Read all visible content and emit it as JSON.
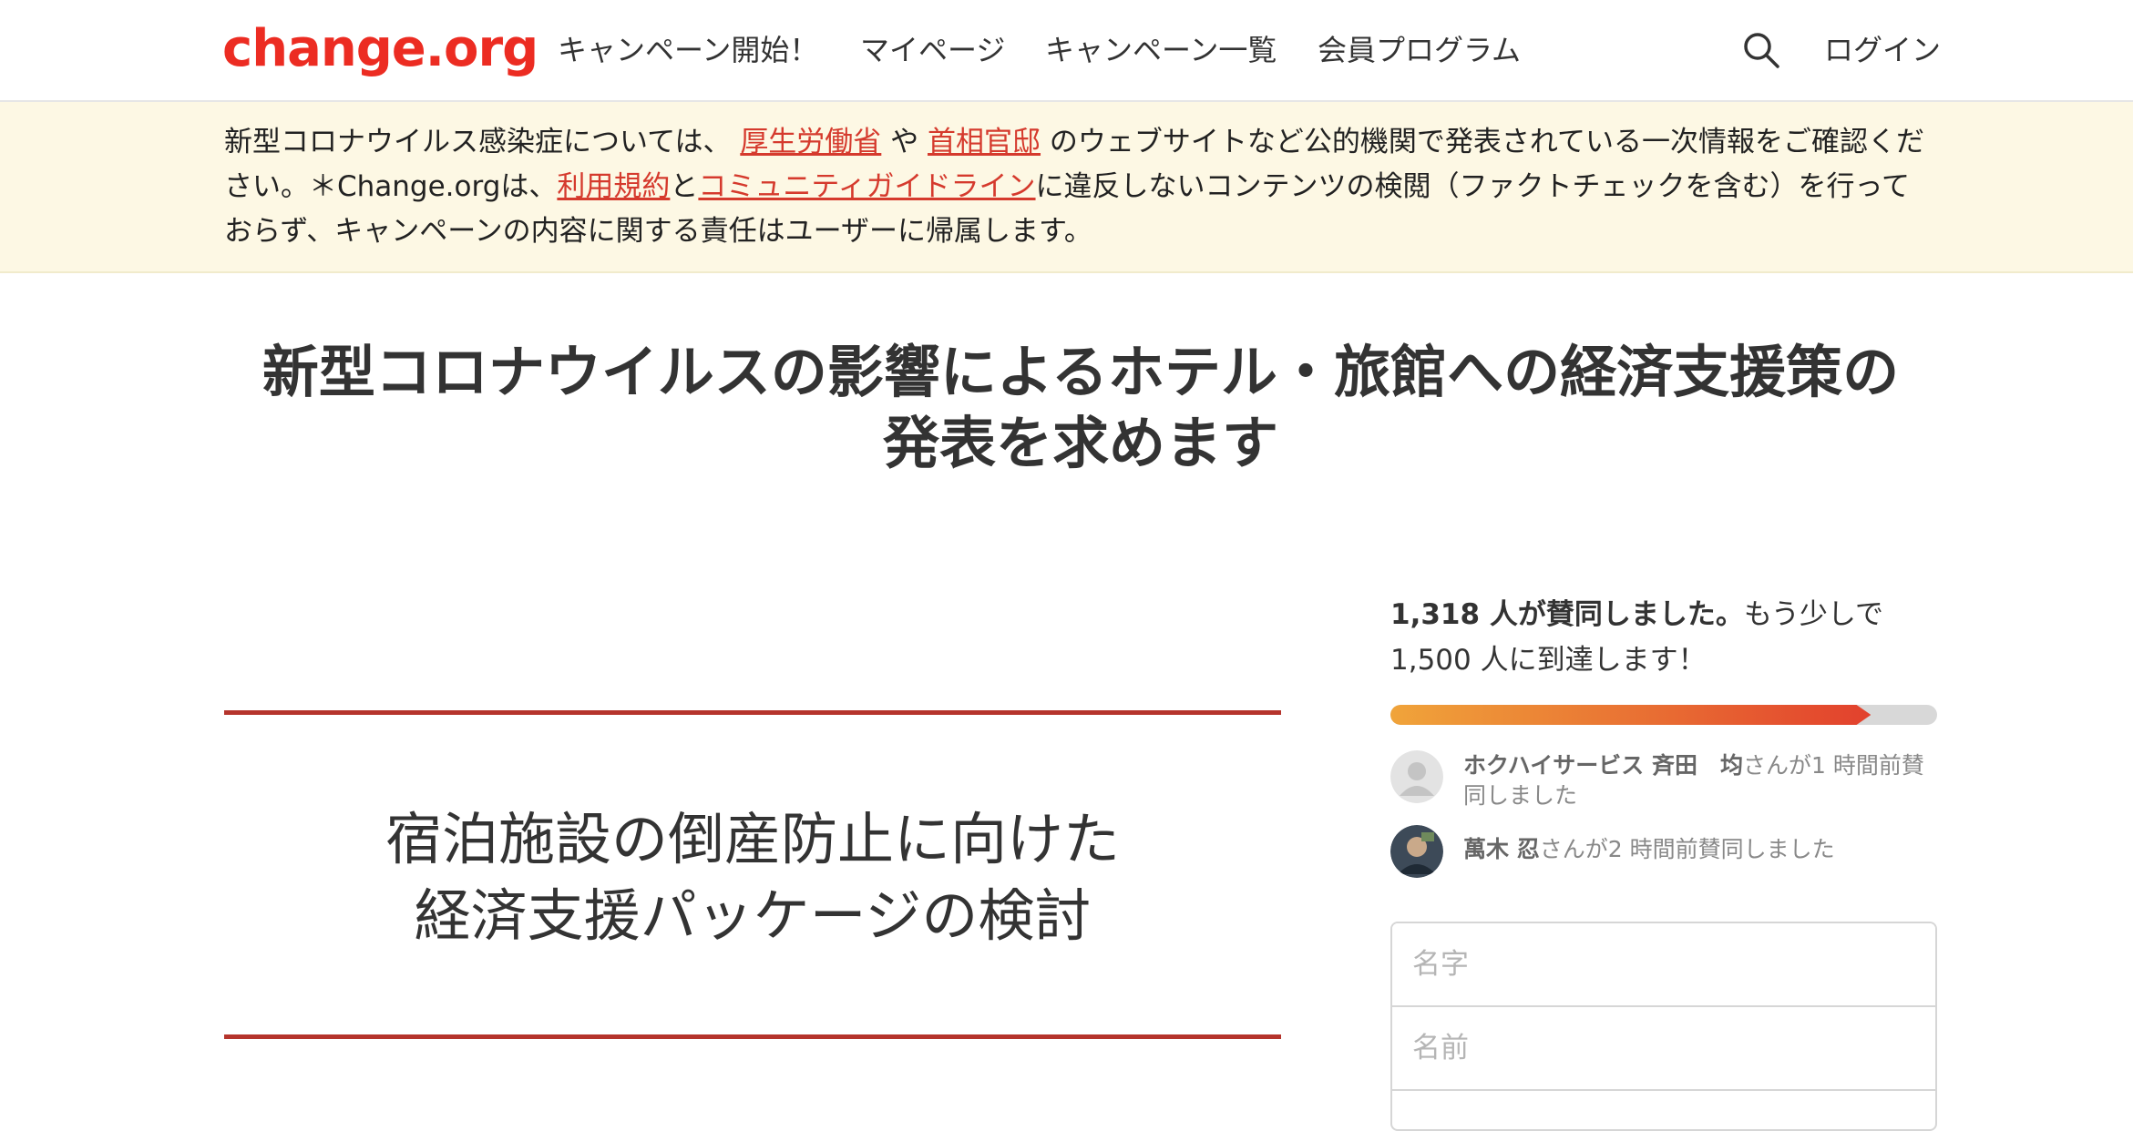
{
  "header": {
    "logo": "change.org",
    "nav": [
      "キャンペーン開始！",
      "マイページ",
      "キャンペーン一覧",
      "会員プログラム"
    ],
    "search_icon": "search-icon",
    "login": "ログイン"
  },
  "notice": {
    "part1": "新型コロナウイルス感染症については、 ",
    "link1": "厚生労働省",
    "part2": " や ",
    "link2": "首相官邸",
    "part3": " のウェブサイトなど公的機関で発表されている一次情報をご確認ください。＊Change.orgは、",
    "link3": "利用規約",
    "part4": "と",
    "link4": "コミュニティガイドライン",
    "part5": "に違反しないコンテンツの検閲（ファクトチェックを含む）を行っておらず、キャンペーンの内容に関する責任はユーザーに帰属します。"
  },
  "title": {
    "line1": "新型コロナウイルスの影響によるホテル・旅館への経済支援策の",
    "line2": "発表を求めます"
  },
  "media": {
    "line1": "宿泊施設の倒産防止に向けた",
    "line2": "経済支援パッケージの検討"
  },
  "signatures": {
    "count_bold": "1,318 人が賛同しました。",
    "count_rest": "もう少しで",
    "goal_text": "1,500 人に到達します！",
    "progress": 0.879,
    "colors": {
      "progress_start": "#f0a43a",
      "progress_end": "#e2412d",
      "brand": "#ec2c22"
    }
  },
  "recent_signers": [
    {
      "name": "ホクハイサービス 斉田　均",
      "suffix": "さんが1 時間前賛同しました"
    },
    {
      "name": "萬木 忍",
      "suffix": "さんが2 時間前賛同しました"
    }
  ],
  "form": {
    "last_name_placeholder": "名字",
    "first_name_placeholder": "名前"
  }
}
